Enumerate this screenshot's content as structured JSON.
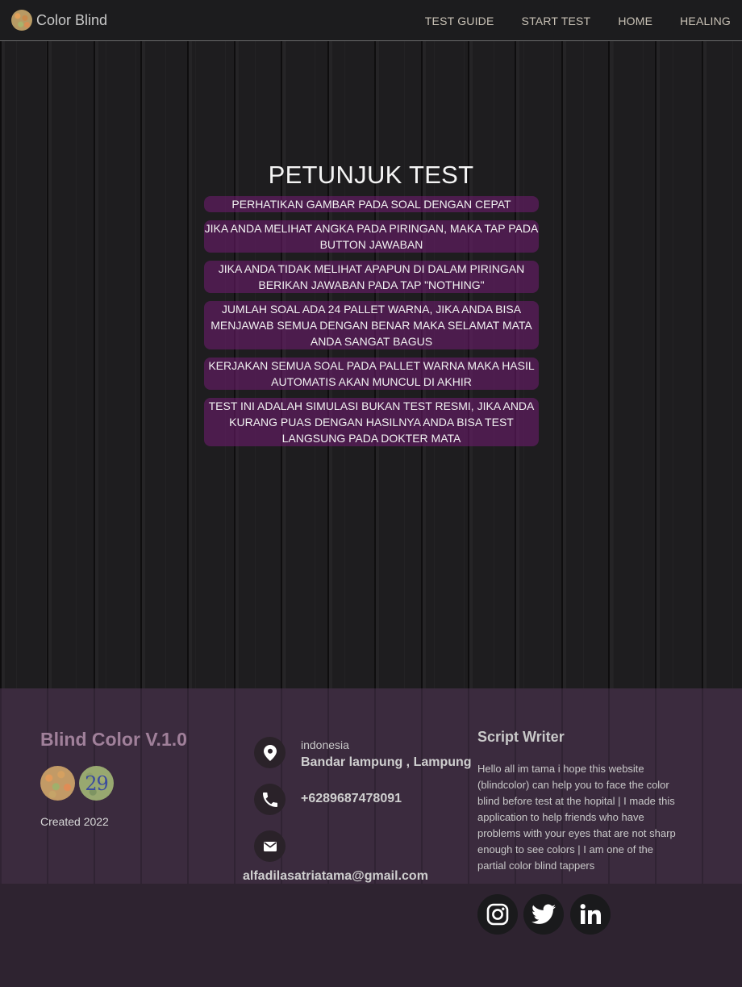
{
  "nav": {
    "brand": "Color Blind",
    "links": [
      "TEST GUIDE",
      "START TEST",
      "HOME",
      "HEALING"
    ]
  },
  "guide": {
    "title": "PETUNJUK TEST",
    "items": [
      "PERHATIKAN GAMBAR PADA SOAL DENGAN CEPAT",
      "JIKA ANDA MELIHAT ANGKA PADA PIRINGAN, MAKA TAP PADA BUTTON JAWABAN",
      "JIKA ANDA TIDAK MELIHAT APAPUN DI DALAM PIRINGAN BERIKAN JAWABAN PADA TAP \"NOTHING\"",
      "JUMLAH SOAL ADA 24 PALLET WARNA, JIKA ANDA BISA MENJAWAB SEMUA DENGAN BENAR MAKA SELAMAT MATA ANDA SANGAT BAGUS",
      "KERJAKAN SEMUA SOAL PADA PALLET WARNA MAKA HASIL AUTOMATIS AKAN MUNCUL DI AKHIR",
      "TEST INI ADALAH SIMULASI BUKAN TEST RESMI, JIKA ANDA KURANG PUAS DENGAN HASILNYA ANDA BISA TEST LANGSUNG PADA DOKTER MATA"
    ]
  },
  "footer": {
    "title": "Blind Color V.1.0",
    "badge_number": "29",
    "created": "Created 2022",
    "location_label": "indonesia",
    "location_value": "Bandar lampung , Lampung",
    "phone": "+6289687478091",
    "email": "alfadilasatriatama@gmail.com",
    "writer_title": "Script Writer",
    "writer_text": "Hello all im tama i hope this website (blindcolor) can help you to face the color blind before test at the hopital | I made this application to help friends who have problems with your eyes that are not sharp enough to see colors | I am one of the partial color blind tappers",
    "social_icons": [
      "instagram-icon",
      "twitter-icon",
      "linkedin-icon"
    ]
  }
}
